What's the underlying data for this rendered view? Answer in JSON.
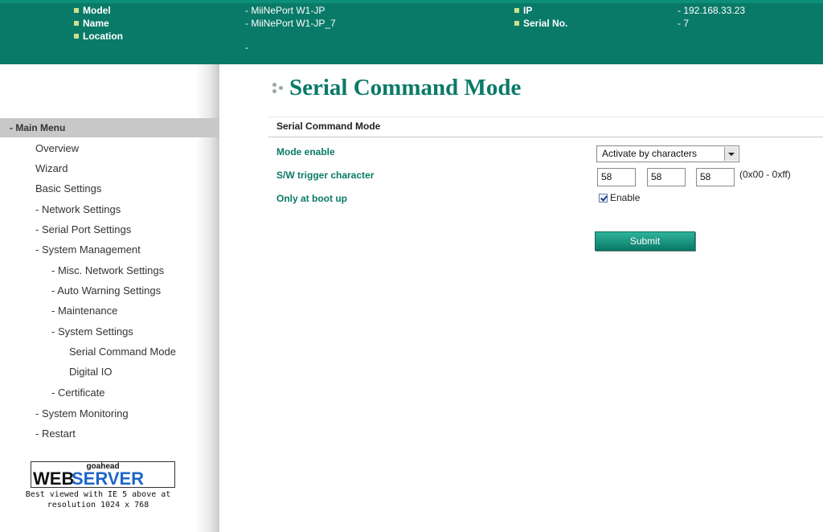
{
  "header": {
    "model_label": "Model",
    "model_value": "- MiiNePort W1-JP",
    "name_label": "Name",
    "name_value": "- MiiNePort W1-JP_7",
    "location_label": "Location",
    "location_value": "-",
    "ip_label": "IP",
    "ip_value": "- 192.168.33.23",
    "serial_label": "Serial No.",
    "serial_value": "- 7"
  },
  "sidebar": {
    "menu_title": "- Main Menu",
    "items": [
      {
        "label": "Overview"
      },
      {
        "label": "Wizard"
      },
      {
        "label": "Basic Settings"
      },
      {
        "label": "- Network Settings"
      },
      {
        "label": "- Serial Port Settings"
      },
      {
        "label": "- System Management"
      },
      {
        "label": "- Misc. Network Settings"
      },
      {
        "label": "- Auto Warning Settings"
      },
      {
        "label": "- Maintenance"
      },
      {
        "label": "- System Settings"
      },
      {
        "label": "Serial Command Mode"
      },
      {
        "label": "Digital IO"
      },
      {
        "label": "- Certificate"
      },
      {
        "label": "- System Monitoring"
      },
      {
        "label": "- Restart"
      }
    ],
    "logo": {
      "top": "goahead",
      "web": "WEB",
      "server": "SERVER",
      "caption_line1": "Best viewed with IE 5 above at",
      "caption_line2": "resolution 1024 x 768"
    }
  },
  "main": {
    "page_title": "Serial Command Mode",
    "section_title": "Serial Command Mode",
    "mode_enable_label": "Mode enable",
    "mode_enable_value": "Activate by characters",
    "trigger_label": "S/W trigger character",
    "trigger_values": [
      "58",
      "58",
      "58"
    ],
    "trigger_range": "(0x00 - 0xff)",
    "boot_label": "Only at boot up",
    "boot_checkbox_label": "Enable",
    "boot_checked": true,
    "submit_label": "Submit"
  },
  "colors": {
    "brand": "#0a7a68",
    "bullet": "#cfe08a",
    "menu_header": "#c8c8c8",
    "logo_accent": "#1e66c8"
  },
  "icons": {
    "header_bullet": "square-bullet-icon",
    "title_decoration": "dots-icon",
    "select_arrow": "chevron-down-icon",
    "checkbox": "checkbox-checked-icon"
  }
}
